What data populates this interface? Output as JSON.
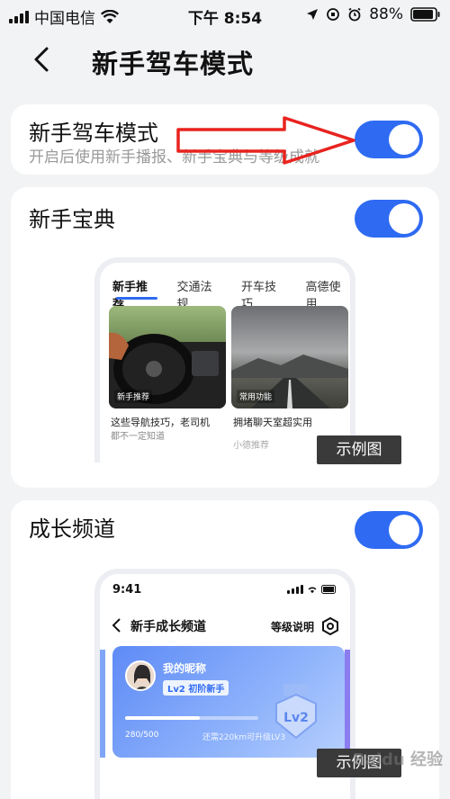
{
  "status_bar": {
    "carrier": "中国电信",
    "time": "下午 8:54",
    "battery": "88%"
  },
  "nav": {
    "title": "新手驾车模式"
  },
  "card_mode": {
    "title": "新手驾车模式",
    "subtitle": "开启后使用新手播报、新手宝典与等级成就",
    "toggle_on": true
  },
  "card_guide": {
    "title": "新手宝典",
    "toggle_on": true,
    "preview": {
      "tabs": [
        "新手推荐",
        "交通法规",
        "开车技巧",
        "高德使用"
      ],
      "articles": [
        {
          "tag": "新手推荐",
          "text_line1": "这些导航技巧，老司机",
          "text_line2": "都不一定知道"
        },
        {
          "tag": "常用功能",
          "text_line1": "拥堵聊天室超实用",
          "text_line2": "小德推荐"
        }
      ]
    },
    "example_label": "示例图"
  },
  "card_growth": {
    "title": "成长频道",
    "toggle_on": true,
    "preview": {
      "time": "9:41",
      "nav_title": "新手成长频道",
      "level_link": "等级说明",
      "nickname": "我的昵称",
      "level_pill": "Lv2 初阶新手",
      "progress_text": "280/500",
      "progress_value": 0.56,
      "progress_hint": "还需220km可升级LV3",
      "medal_text": "Lv2"
    },
    "example_label": "示例图"
  },
  "watermark": "Baidu 经验",
  "colors": {
    "accent": "#2f6bf2",
    "arrow": "#e8231f",
    "background": "#f2f3f5"
  }
}
